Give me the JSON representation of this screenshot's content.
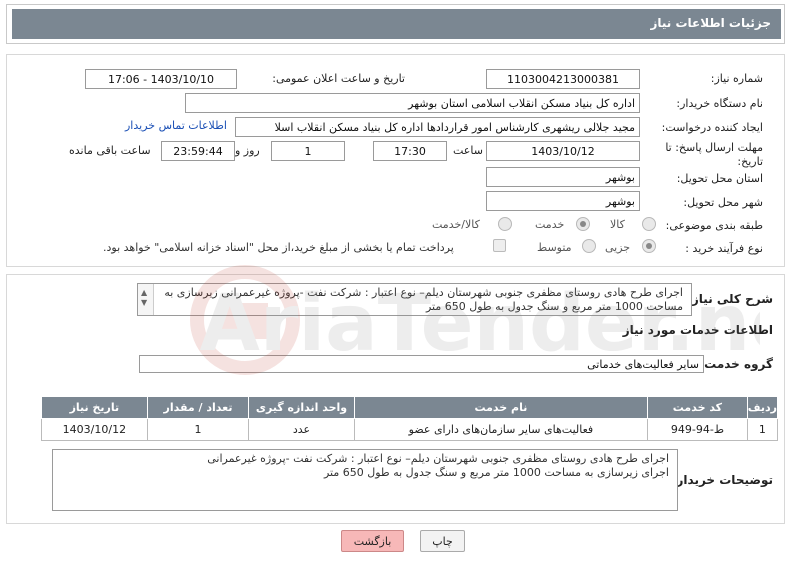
{
  "header": {
    "title": "جزئیات اطلاعات نیاز"
  },
  "form": {
    "need_number_label": "شماره نیاز:",
    "need_number": "1103004213000381",
    "announce_label": "تاریخ و ساعت اعلان عمومی:",
    "announce_value": "1403/10/10 - 17:06",
    "buyer_label": "نام دستگاه خریدار:",
    "buyer_value": "اداره کل بنیاد مسکن انقلاب اسلامی استان بوشهر",
    "creator_label": "ایجاد کننده درخواست:",
    "creator_value": "مجید جلالی ریشهری کارشناس امور قراردادها اداره کل بنیاد مسکن انقلاب اسلا",
    "contact_link": "اطلاعات تماس خریدار",
    "deadline_label": "مهلت ارسال پاسخ: تا تاریخ:",
    "deadline_date": "1403/10/12",
    "time_label": "ساعت",
    "deadline_time": "17:30",
    "days_value": "1",
    "days_label": "روز و",
    "remaining_time": "23:59:44",
    "remaining_label": "ساعت باقی مانده",
    "province_label": "استان محل تحویل:",
    "province_value": "بوشهر",
    "city_label": "شهر محل تحویل:",
    "city_value": "بوشهر",
    "category_label": "طبقه بندی موضوعی:",
    "category_options": [
      "کالا",
      "خدمت",
      "کالا/خدمت"
    ],
    "process_label": "نوع فرآیند خرید :",
    "process_options": [
      "جزیی",
      "متوسط"
    ],
    "payment_note": "پرداخت تمام یا بخشی از مبلغ خرید،از محل \"اسناد خزانه اسلامی\" خواهد بود."
  },
  "description": {
    "general_label": "شرح کلی نیاز:",
    "general_text": "اجرای طرح هادی روستای مظفری جنوبی شهرستان دیلم– نوع اعتبار : شرکت نفت -پروژه غیرعمرانی زیرسازی به مساحت 1000 متر مربع و سنگ جدول به طول 650 متر",
    "services_title": "اطلاعات خدمات مورد نیاز",
    "group_label": "گروه خدمت:",
    "group_value": "سایر فعالیت‌های خدماتی",
    "table": {
      "headers": [
        "ردیف",
        "کد خدمت",
        "نام خدمت",
        "واحد اندازه گیری",
        "تعداد / مقدار",
        "تاریخ نیاز"
      ],
      "rows": [
        [
          "1",
          "ط-94-949",
          "فعالیت‌های سایر سازمان‌های دارای عضو",
          "عدد",
          "1",
          "1403/10/12"
        ]
      ]
    },
    "buyer_notes_label": "توضیحات خریدار:",
    "buyer_notes_line1": "اجرای طرح هادی روستای مظفری جنوبی شهرستان دیلم– نوع اعتبار : شرکت نفت -پروژه غیرعمرانی",
    "buyer_notes_line2": "اجرای زیرسازی به مساحت 1000 متر مربع و سنگ جدول به طول 650 متر"
  },
  "buttons": {
    "print": "چاپ",
    "back": "بازگشت"
  },
  "watermark": "AriaTender.net",
  "colors": {
    "header_bg": "#7b8792",
    "back_button": "#f7b8b8",
    "link": "#1a4fb5"
  }
}
